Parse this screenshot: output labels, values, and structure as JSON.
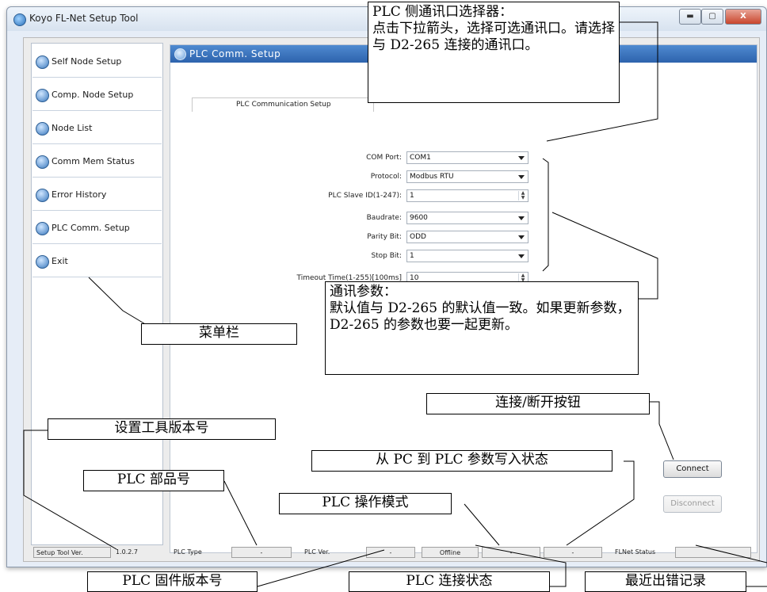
{
  "window": {
    "title": "Koyo FL-Net Setup Tool",
    "controls": {
      "minimize": "▬",
      "maximize": "▢",
      "close": "X"
    }
  },
  "menu": {
    "items": [
      {
        "label": "Self Node Setup",
        "icon": "circle-arrow-icon"
      },
      {
        "label": "Comp. Node Setup",
        "icon": "stop-circle-icon"
      },
      {
        "label": "Node List",
        "icon": "list-circle-icon"
      },
      {
        "label": "Comm Mem Status",
        "icon": "status-circle-icon"
      },
      {
        "label": "Error History",
        "icon": "history-circle-icon"
      },
      {
        "label": "PLC Comm. Setup",
        "icon": "plc-circle-icon"
      },
      {
        "label": "Exit",
        "icon": "exit-circle-icon"
      }
    ]
  },
  "panel": {
    "title": "PLC Comm. Setup",
    "group_title": "PLC Communication Setup"
  },
  "form": {
    "com_port": {
      "label": "COM Port:",
      "value": "COM1"
    },
    "protocol": {
      "label": "Protocol:",
      "value": "Modbus RTU"
    },
    "slave_id": {
      "label": "PLC Slave ID(1-247):",
      "value": "1"
    },
    "baudrate": {
      "label": "Baudrate:",
      "value": "9600"
    },
    "parity": {
      "label": "Parity Bit:",
      "value": "ODD"
    },
    "stop_bit": {
      "label": "Stop Bit:",
      "value": "1"
    },
    "timeout": {
      "label": "Timeout Time(1-255)[100ms]",
      "value": "10"
    }
  },
  "buttons": {
    "connect": "Connect",
    "disconnect": "Disconnect"
  },
  "status_bar": {
    "setup_ver_label": "Setup Tool Ver.",
    "setup_ver_value": "1.0.2.7",
    "plc_type_label": "PLC Type",
    "plc_type_value": "-",
    "plc_ver_label": "PLC Ver.",
    "plc_ver_value": "-",
    "conn_state": "Offline",
    "mode_value": "-",
    "write_status": "-",
    "flnet_status_label": "FLNet Status"
  },
  "callouts": {
    "com_selector": "PLC 侧通讯口选择器：\n点击下拉箭头，选择可选通讯口。请选择与 D2-265 连接的通讯口。",
    "comm_params": "通讯参数：\n默认值与 D2-265 的默认值一致。如果更新参数，D2-265 的参数也要一起更新。",
    "menu_bar": "菜单栏",
    "connect_btn": "连接/断开按钮",
    "tool_version": "设置工具版本号",
    "write_status": "从 PC 到 PLC 参数写入状态",
    "plc_part_no": "PLC 部品号",
    "plc_mode": "PLC 操作模式",
    "plc_firmware": "PLC 固件版本号",
    "plc_conn_state": "PLC 连接状态",
    "recent_error": "最近出错记录"
  }
}
